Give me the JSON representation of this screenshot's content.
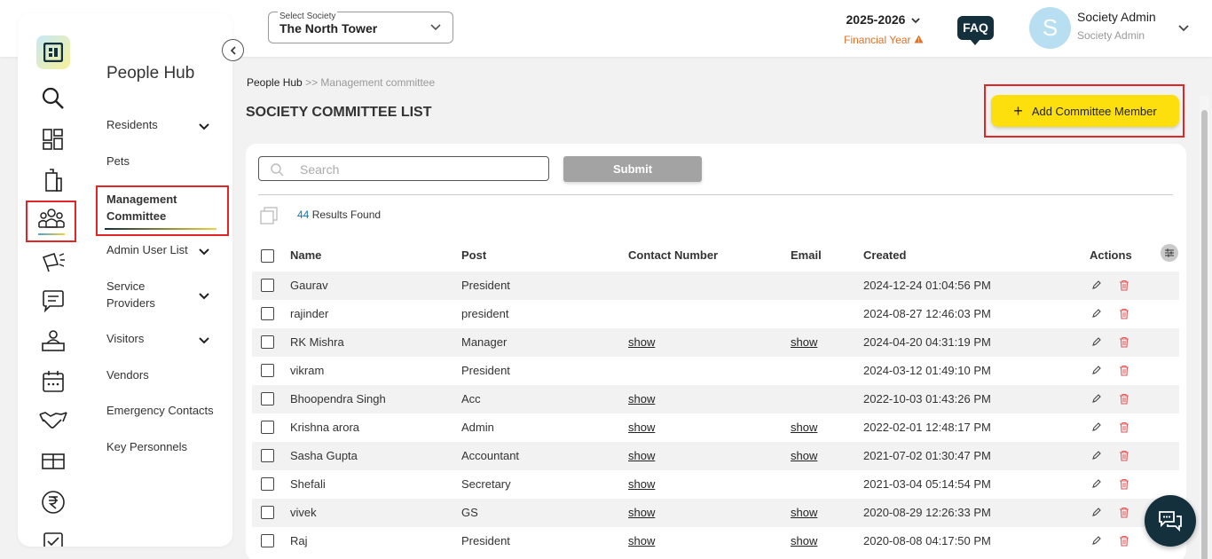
{
  "header": {
    "society_label": "Select Society",
    "society_value": "The North Tower",
    "financial_year": "2025-2026",
    "financial_year_label": "Financial Year",
    "faq": "FAQ",
    "avatar_initial": "S",
    "user_name": "Society Admin",
    "user_role": "Society Admin"
  },
  "sidebar": {
    "title": "People Hub",
    "items": [
      {
        "label": "Residents",
        "has_children": true
      },
      {
        "label": "Pets",
        "has_children": false
      },
      {
        "label": "Management Committee",
        "has_children": false,
        "active": true
      },
      {
        "label": "Admin User List",
        "has_children": true
      },
      {
        "label": "Service Providers",
        "has_children": true
      },
      {
        "label": "Visitors",
        "has_children": true
      },
      {
        "label": "Vendors",
        "has_children": false
      },
      {
        "label": "Emergency Contacts",
        "has_children": false
      },
      {
        "label": "Key Personnels",
        "has_children": false
      }
    ],
    "rail_icons": [
      "logo-icon",
      "search-icon",
      "dashboard-icon",
      "building-icon",
      "people-icon",
      "megaphone-icon",
      "chat-icon",
      "helpdesk-icon",
      "calendar-icon",
      "handshake-icon",
      "amenity-icon",
      "rupee-icon",
      "report-icon"
    ]
  },
  "breadcrumb": {
    "root": "People Hub",
    "separator": ">>",
    "current": "Management committee"
  },
  "page": {
    "title": "SOCIETY COMMITTEE LIST",
    "add_button": "Add Committee Member"
  },
  "search": {
    "placeholder": "Search",
    "submit": "Submit"
  },
  "results": {
    "count": "44",
    "label": "Results Found"
  },
  "table": {
    "columns": [
      "Name",
      "Post",
      "Contact Number",
      "Email",
      "Created",
      "Actions"
    ],
    "rows": [
      {
        "name": "Gaurav",
        "post": "President",
        "contact": "",
        "email": "",
        "created": "2024-12-24 01:04:56 PM"
      },
      {
        "name": "rajinder",
        "post": "president",
        "contact": "",
        "email": "",
        "created": "2024-08-27 12:46:03 PM"
      },
      {
        "name": "RK Mishra",
        "post": "Manager",
        "contact": "show",
        "email": "show",
        "created": "2024-04-20 04:31:19 PM"
      },
      {
        "name": "vikram",
        "post": "President",
        "contact": "",
        "email": "",
        "created": "2024-03-12 01:49:10 PM"
      },
      {
        "name": "Bhoopendra Singh",
        "post": "Acc",
        "contact": "show",
        "email": "",
        "created": "2022-10-03 01:43:26 PM"
      },
      {
        "name": "Krishna arora",
        "post": "Admin",
        "contact": "show",
        "email": "show",
        "created": "2022-02-01 12:48:17 PM"
      },
      {
        "name": "Sasha Gupta",
        "post": "Accountant",
        "contact": "show",
        "email": "show",
        "created": "2021-07-02 01:30:47 PM"
      },
      {
        "name": "Shefali",
        "post": "Secretary",
        "contact": "show",
        "email": "",
        "created": "2021-03-04 05:14:54 PM"
      },
      {
        "name": "vivek",
        "post": "GS",
        "contact": "show",
        "email": "show",
        "created": "2020-08-29 12:26:33 PM"
      },
      {
        "name": "Raj",
        "post": "President",
        "contact": "show",
        "email": "show",
        "created": "2020-08-08 04:17:50 PM"
      }
    ]
  },
  "colors": {
    "accent_yellow": "#fddf0d",
    "dark_navy": "#14303c",
    "highlight_red": "#e02626",
    "warning_orange": "#e0702a",
    "delete_red": "#e25555"
  }
}
